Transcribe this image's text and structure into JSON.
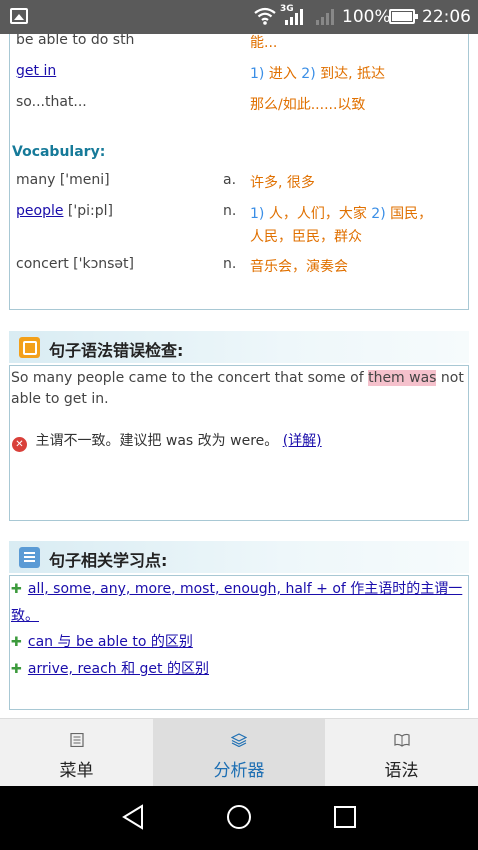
{
  "status_bar": {
    "network": "3G",
    "battery": "100%",
    "time": "22:06"
  },
  "phrases": [
    {
      "en": "be able to do sth",
      "cn": "能..."
    },
    {
      "en": "get in",
      "cn_1_num": "1)",
      "cn_1": "进入",
      "cn_2_num": "2)",
      "cn_2": "到达, 抵达"
    },
    {
      "en": "so...that...",
      "cn": "那么/如此......以致"
    }
  ],
  "vocabulary": {
    "title": "Vocabulary:",
    "items": [
      {
        "word": "many",
        "phonetic": "['meni]",
        "pos": "a.",
        "meaning": "许多, 很多"
      },
      {
        "word": "people",
        "phonetic": "['pi:pl]",
        "pos": "n.",
        "meaning_1_num": "1)",
        "meaning_1": "人，人们，大家",
        "meaning_2_num": "2)",
        "meaning_2a": "国民，",
        "meaning_2b": "人民，臣民，群众"
      },
      {
        "word": "concert",
        "phonetic": "['kɔnsət]",
        "pos": "n.",
        "meaning": "音乐会，演奏会"
      }
    ]
  },
  "grammar_check": {
    "title": "句子语法错误检查:",
    "sentence_before": "So many people came to the concert that some of ",
    "sentence_highlight": "them was",
    "sentence_after": " not able to get in.",
    "error_text": "主谓不一致。建议把 was 改为 were。",
    "detail_link": "(详解)"
  },
  "learning_points": {
    "title": "句子相关学习点:",
    "items": [
      "all, some, any, more, most, enough, half + of 作主语时的主谓一致。",
      "can 与 be able to 的区别",
      "arrive, reach 和 get 的区别"
    ]
  },
  "tabs": [
    {
      "label": "菜单"
    },
    {
      "label": "分析器"
    },
    {
      "label": "语法"
    }
  ],
  "colors": {
    "accent": "#1e6fb3",
    "chinese_text": "#e07000",
    "highlight": "#f5c1cc",
    "section_title": "#167a99"
  }
}
